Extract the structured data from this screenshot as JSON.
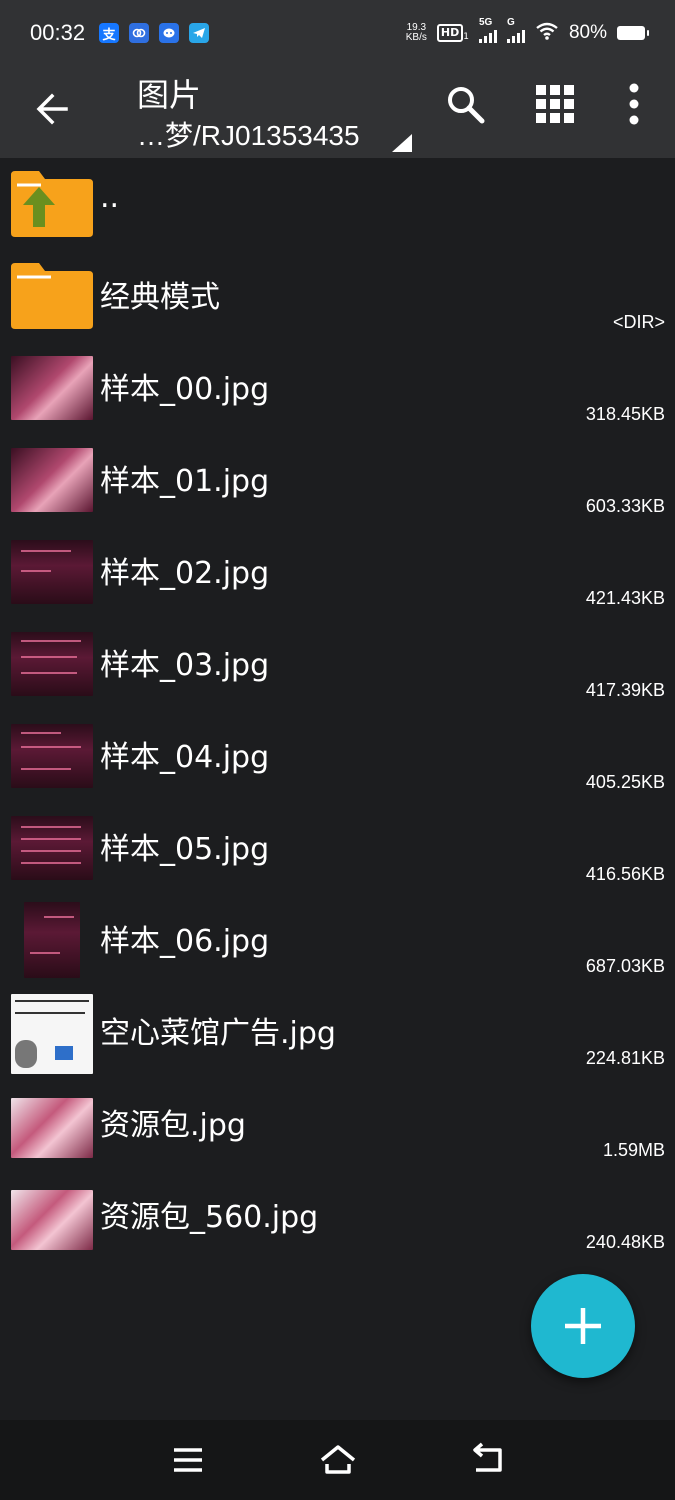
{
  "status_bar": {
    "time": "00:32",
    "app_icons": [
      "alipay-icon",
      "cloud-app-icon",
      "chat-app-icon",
      "telegram-icon"
    ],
    "alipay_char": "支",
    "net_speed_value": "19.3",
    "net_speed_unit": "KB/s",
    "hd_badge": "HD",
    "hd_sub": "1",
    "signal1_label": "5G",
    "signal2_label": "G",
    "battery": "80%"
  },
  "toolbar": {
    "title": "图片",
    "path": "…梦/RJ01353435"
  },
  "files": [
    {
      "name": "..",
      "size": "",
      "type": "parent-folder"
    },
    {
      "name": "经典模式",
      "size": "<DIR>",
      "type": "folder"
    },
    {
      "name": "样本_00.jpg",
      "size": "318.45KB",
      "type": "image",
      "thumb": "pink"
    },
    {
      "name": "样本_01.jpg",
      "size": "603.33KB",
      "type": "image",
      "thumb": "pink"
    },
    {
      "name": "样本_02.jpg",
      "size": "421.43KB",
      "type": "image",
      "thumb": "dark"
    },
    {
      "name": "样本_03.jpg",
      "size": "417.39KB",
      "type": "image",
      "thumb": "dark"
    },
    {
      "name": "样本_04.jpg",
      "size": "405.25KB",
      "type": "image",
      "thumb": "dark"
    },
    {
      "name": "样本_05.jpg",
      "size": "416.56KB",
      "type": "image",
      "thumb": "dark"
    },
    {
      "name": "样本_06.jpg",
      "size": "687.03KB",
      "type": "image",
      "thumb": "dark"
    },
    {
      "name": "空心菜馆广告.jpg",
      "size": "224.81KB",
      "type": "image",
      "thumb": "white"
    },
    {
      "name": "资源包.jpg",
      "size": "1.59MB",
      "type": "image",
      "thumb": "cover"
    },
    {
      "name": "资源包_560.jpg",
      "size": "240.48KB",
      "type": "image",
      "thumb": "cover"
    }
  ],
  "colors": {
    "background": "#1c1d1f",
    "toolbar": "#313234",
    "folder": "#f7a21b",
    "up_arrow": "#6a8f1f",
    "fab": "#1fb8d0"
  }
}
